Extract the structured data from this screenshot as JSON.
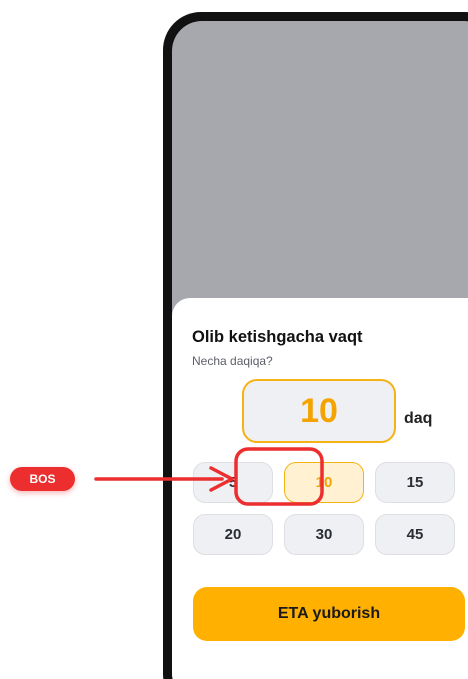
{
  "sheet": {
    "title": "Olib ketishgacha vaqt",
    "subtitle": "Necha daqiqa?",
    "value": "10",
    "unit": "daq",
    "presets": [
      "5",
      "10",
      "15",
      "20",
      "30",
      "45"
    ],
    "selected_preset": "10",
    "submit_label": "ETA yuborish"
  },
  "annotation": {
    "badge_label": "BOS",
    "color": "#ec2e2e"
  },
  "colors": {
    "accent": "#ffb000",
    "accent_text": "#f4a300",
    "backdrop": "#a7a8ad",
    "chip_bg": "#eef0f3"
  }
}
